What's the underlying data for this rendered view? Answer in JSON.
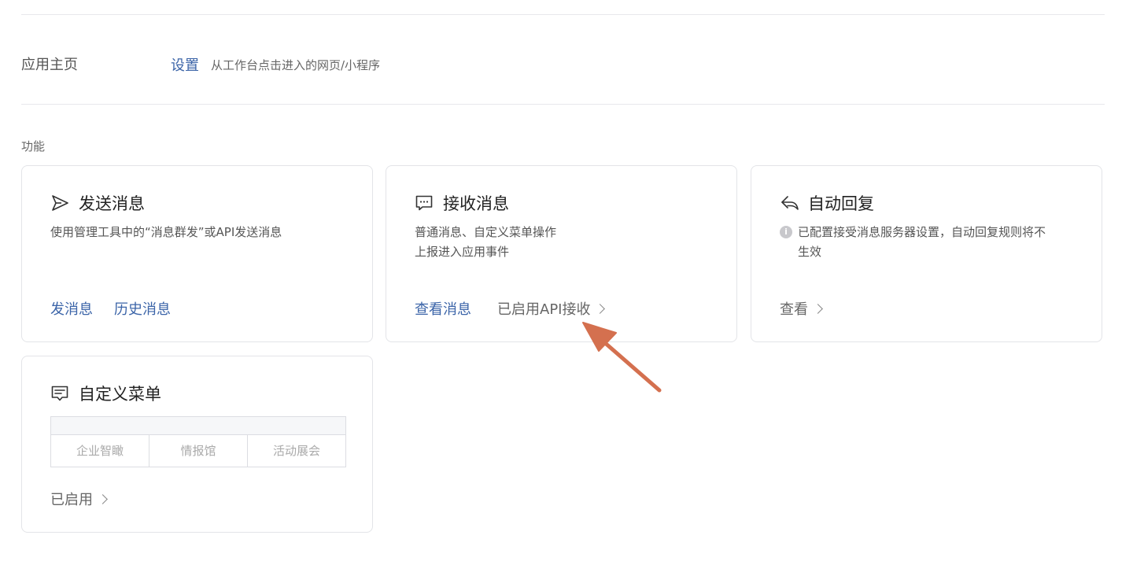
{
  "home": {
    "label": "应用主页",
    "link": "设置",
    "desc": "从工作台点击进入的网页/小程序"
  },
  "section": {
    "label": "功能"
  },
  "cards": {
    "send": {
      "icon": "send-icon",
      "title": "发送消息",
      "desc": "使用管理工具中的“消息群发”或API发送消息",
      "action1": "发消息",
      "action2": "历史消息"
    },
    "receive": {
      "icon": "chat-bubble-icon",
      "title": "接收消息",
      "desc_line1": "普通消息、自定义菜单操作",
      "desc_line2": "上报进入应用事件",
      "action1": "查看消息",
      "status": "已启用API接收"
    },
    "autoreply": {
      "icon": "reply-icon",
      "title": "自动回复",
      "desc_line1": "已配置接受消息服务器设置，自动回复规则将不",
      "desc_line2": "生效",
      "action": "查看"
    },
    "menu": {
      "icon": "menu-icon",
      "title": "自定义菜单",
      "items": [
        "企业智瞰",
        "情报馆",
        "活动展会"
      ],
      "status": "已启用"
    }
  },
  "colors": {
    "link": "#3b64a8",
    "annotation_arrow": "#d4704f"
  }
}
